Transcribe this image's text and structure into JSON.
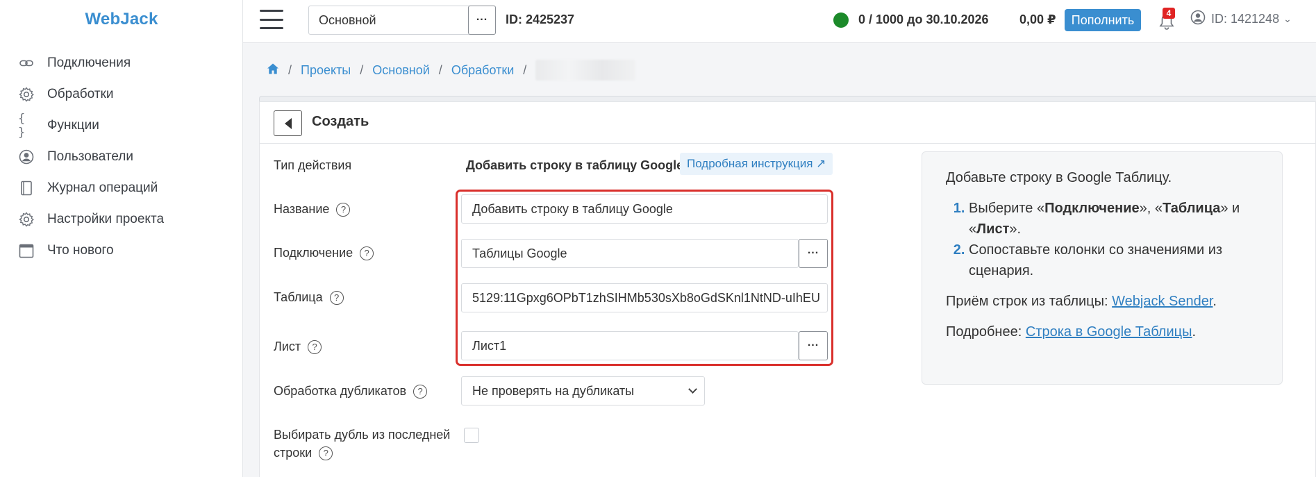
{
  "brand": "WebJack",
  "sidebar": {
    "items": [
      {
        "label": "Подключения",
        "icon": "link-icon"
      },
      {
        "label": "Обработки",
        "icon": "gear-icon"
      },
      {
        "label": "Функции",
        "icon": "braces-icon"
      },
      {
        "label": "Пользователи",
        "icon": "user-circle-icon"
      },
      {
        "label": "Журнал операций",
        "icon": "journal-icon"
      },
      {
        "label": "Настройки проекта",
        "icon": "gear-icon"
      },
      {
        "label": "Что нового",
        "icon": "calendar-icon"
      }
    ]
  },
  "topbar": {
    "project": "Основной",
    "project_id": "ID: 2425237",
    "limit": "0 / 1000 до 30.10.2026",
    "balance": "0,00 ₽",
    "topup_label": "Пополнить",
    "notifications": "4",
    "user_id": "ID: 1421248",
    "status_color": "#1c8a2a"
  },
  "breadcrumb": {
    "items": [
      "Проекты",
      "Основной",
      "Обработки"
    ]
  },
  "card": {
    "title": "Создать"
  },
  "form": {
    "action_type_label": "Тип действия",
    "action_type_value": "Добавить строку в таблицу Google",
    "instruction_label": "Подробная инструкция ↗",
    "name_label": "Название",
    "name_value": "Добавить строку в таблицу Google",
    "connection_label": "Подключение",
    "connection_value": "Таблицы Google",
    "table_label": "Таблица",
    "table_value": "5129:11Gpxg6OPbT1zhSIHMb530sXb8oGdSKnl1NtND-uIhEU",
    "sheet_label": "Лист",
    "sheet_value": "Лист1",
    "duplicates_label": "Обработка дубликатов",
    "duplicates_value": "Не проверять на дубликаты",
    "last_row_label_1": "Выбирать дубль из последней",
    "last_row_label_2": "строки",
    "last_row_checked": false
  },
  "info": {
    "intro": "Добавьте строку в Google Таблицу.",
    "step1_a": "Выберите «",
    "step1_b": "Подключение",
    "step1_c": "», «",
    "step1_d": "Таблица",
    "step1_e": "» и «",
    "step1_f": "Лист",
    "step1_g": "».",
    "step2": "Сопоставьте колонки со значениями из сценария.",
    "receive_prefix": "Приём строк из таблицы: ",
    "receive_link": "Webjack Sender",
    "receive_suffix": ".",
    "more_prefix": "Подробнее: ",
    "more_link": "Строка в Google Таблицы",
    "more_suffix": "."
  }
}
